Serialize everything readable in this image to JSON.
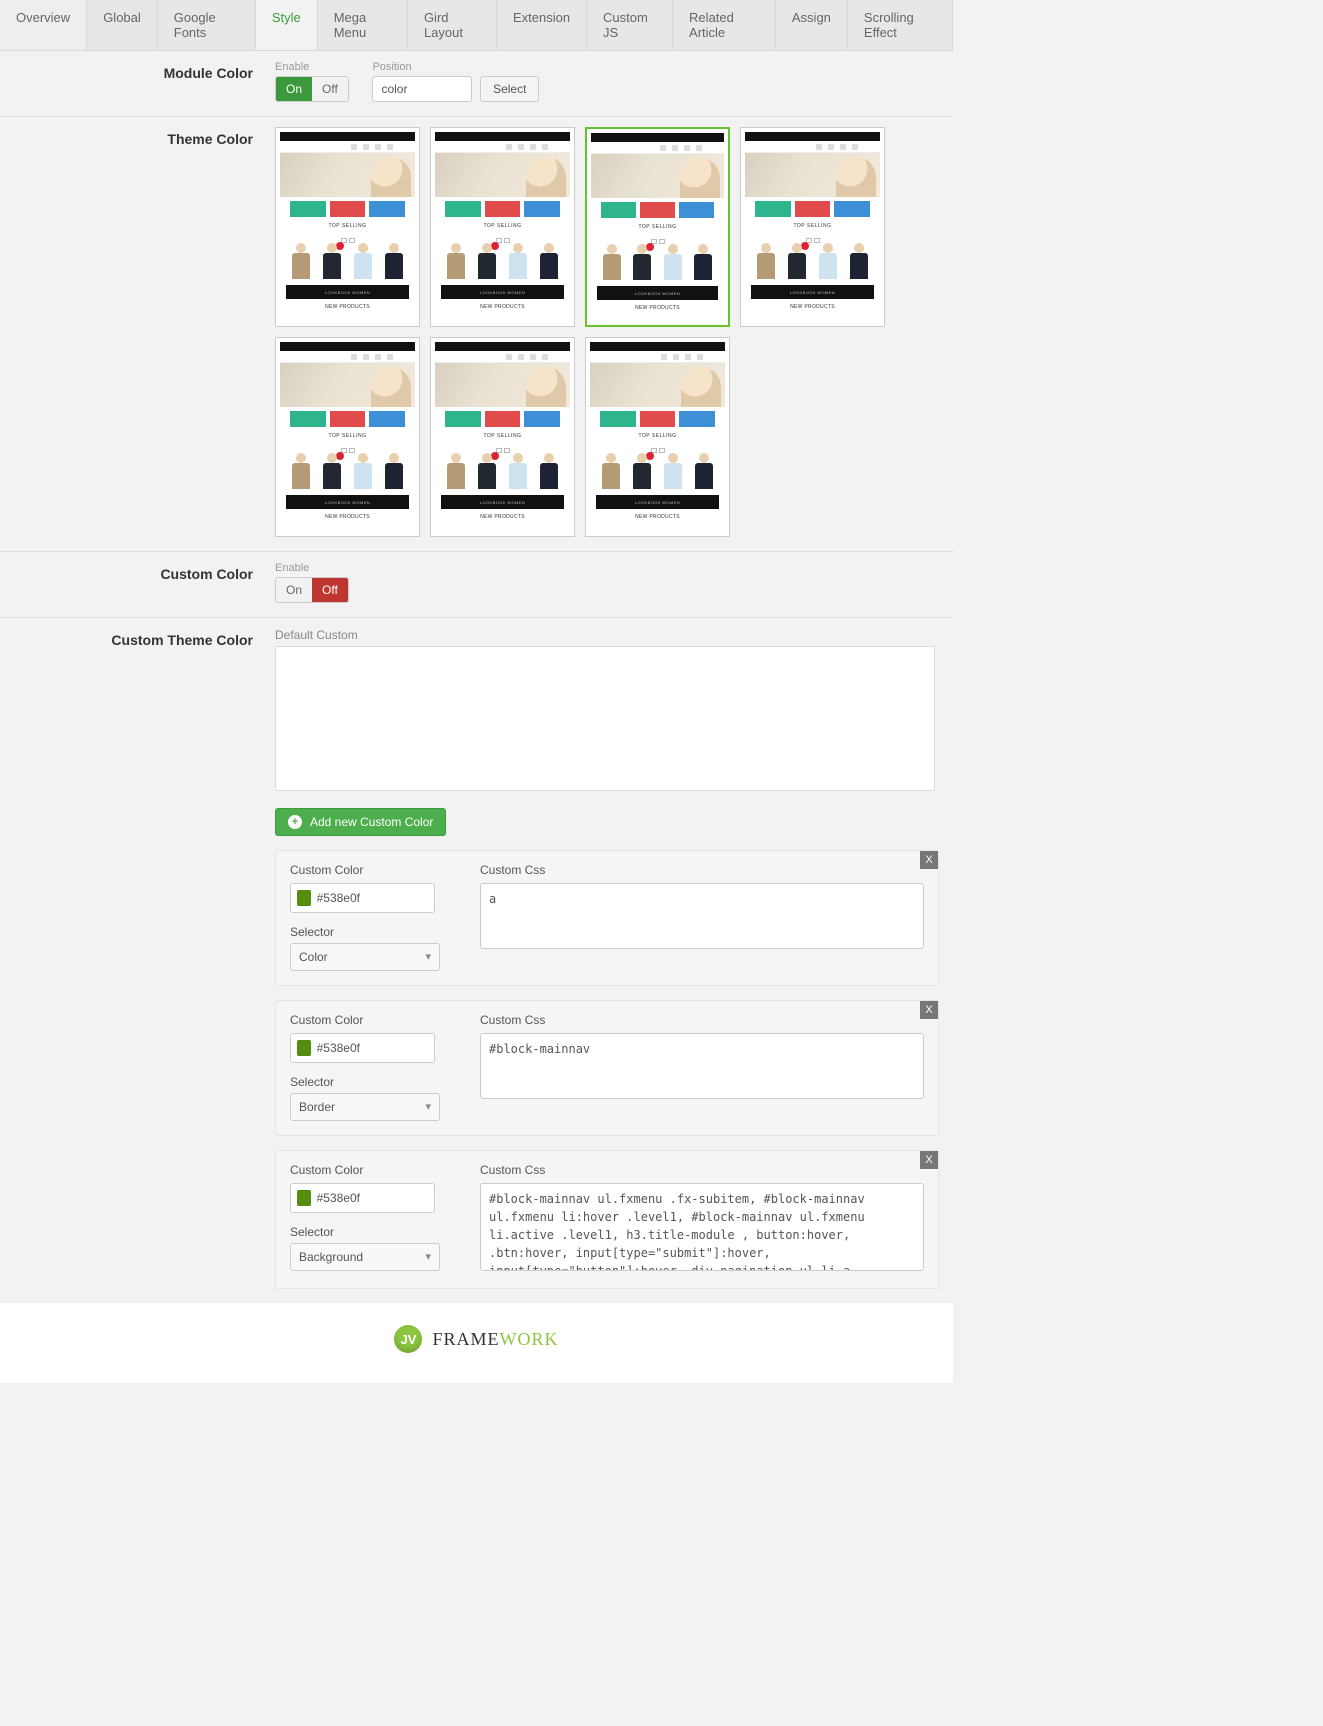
{
  "tabs": {
    "overview": "Overview",
    "global": "Global",
    "googleFonts": "Google Fonts",
    "style": "Style",
    "megaMenu": "Mega Menu",
    "gridLayout": "Gird Layout",
    "extension": "Extension",
    "customJs": "Custom JS",
    "relatedArticle": "Related Article",
    "assign": "Assign",
    "scrollingEffect": "Scrolling Effect",
    "active": "style"
  },
  "sections": {
    "moduleColor": {
      "label": "Module Color",
      "enableLabel": "Enable",
      "enable": {
        "on": "On",
        "off": "Off",
        "value": "on"
      },
      "positionLabel": "Position",
      "positionValue": "color",
      "selectBtn": "Select"
    },
    "themeColor": {
      "label": "Theme Color",
      "thumbs": {
        "count": 7,
        "selectedIndex": 2,
        "topSelling": "TOP SELLING",
        "lookbook": "LOOKBOOK WOMEN",
        "newProducts": "NEW PRODUCTS"
      }
    },
    "customColor": {
      "label": "Custom Color",
      "enableLabel": "Enable",
      "enable": {
        "on": "On",
        "off": "Off",
        "value": "off"
      }
    },
    "customThemeColor": {
      "label": "Custom Theme Color",
      "defaultLabel": "Default Custom",
      "defaultValue": "",
      "addBtn": "Add new Custom Color",
      "rows": [
        {
          "colorLabel": "Custom Color",
          "colorValue": "#538e0f",
          "swatch": "#538e0f",
          "selectorLabel": "Selector",
          "selectorValue": "Color",
          "cssLabel": "Custom Css",
          "cssValue": "a"
        },
        {
          "colorLabel": "Custom Color",
          "colorValue": "#538e0f",
          "swatch": "#538e0f",
          "selectorLabel": "Selector",
          "selectorValue": "Border",
          "cssLabel": "Custom Css",
          "cssValue": "#block-mainnav"
        },
        {
          "colorLabel": "Custom Color",
          "colorValue": "#538e0f",
          "swatch": "#538e0f",
          "selectorLabel": "Selector",
          "selectorValue": "Background",
          "cssLabel": "Custom Css",
          "cssValue": "#block-mainnav ul.fxmenu .fx-subitem, #block-mainnav ul.fxmenu li:hover .level1, #block-mainnav ul.fxmenu li.active .level1, h3.title-module , button:hover, .btn:hover, input[type=\"submit\"]:hover, input[type=\"button\"]:hover, div.pagination ul li a, div.pagination .counter, a.flexMenuToggle"
        }
      ],
      "closeX": "X"
    }
  },
  "footer": {
    "badge": "JV",
    "brand1": "FRAME",
    "brand2": "WORK"
  }
}
